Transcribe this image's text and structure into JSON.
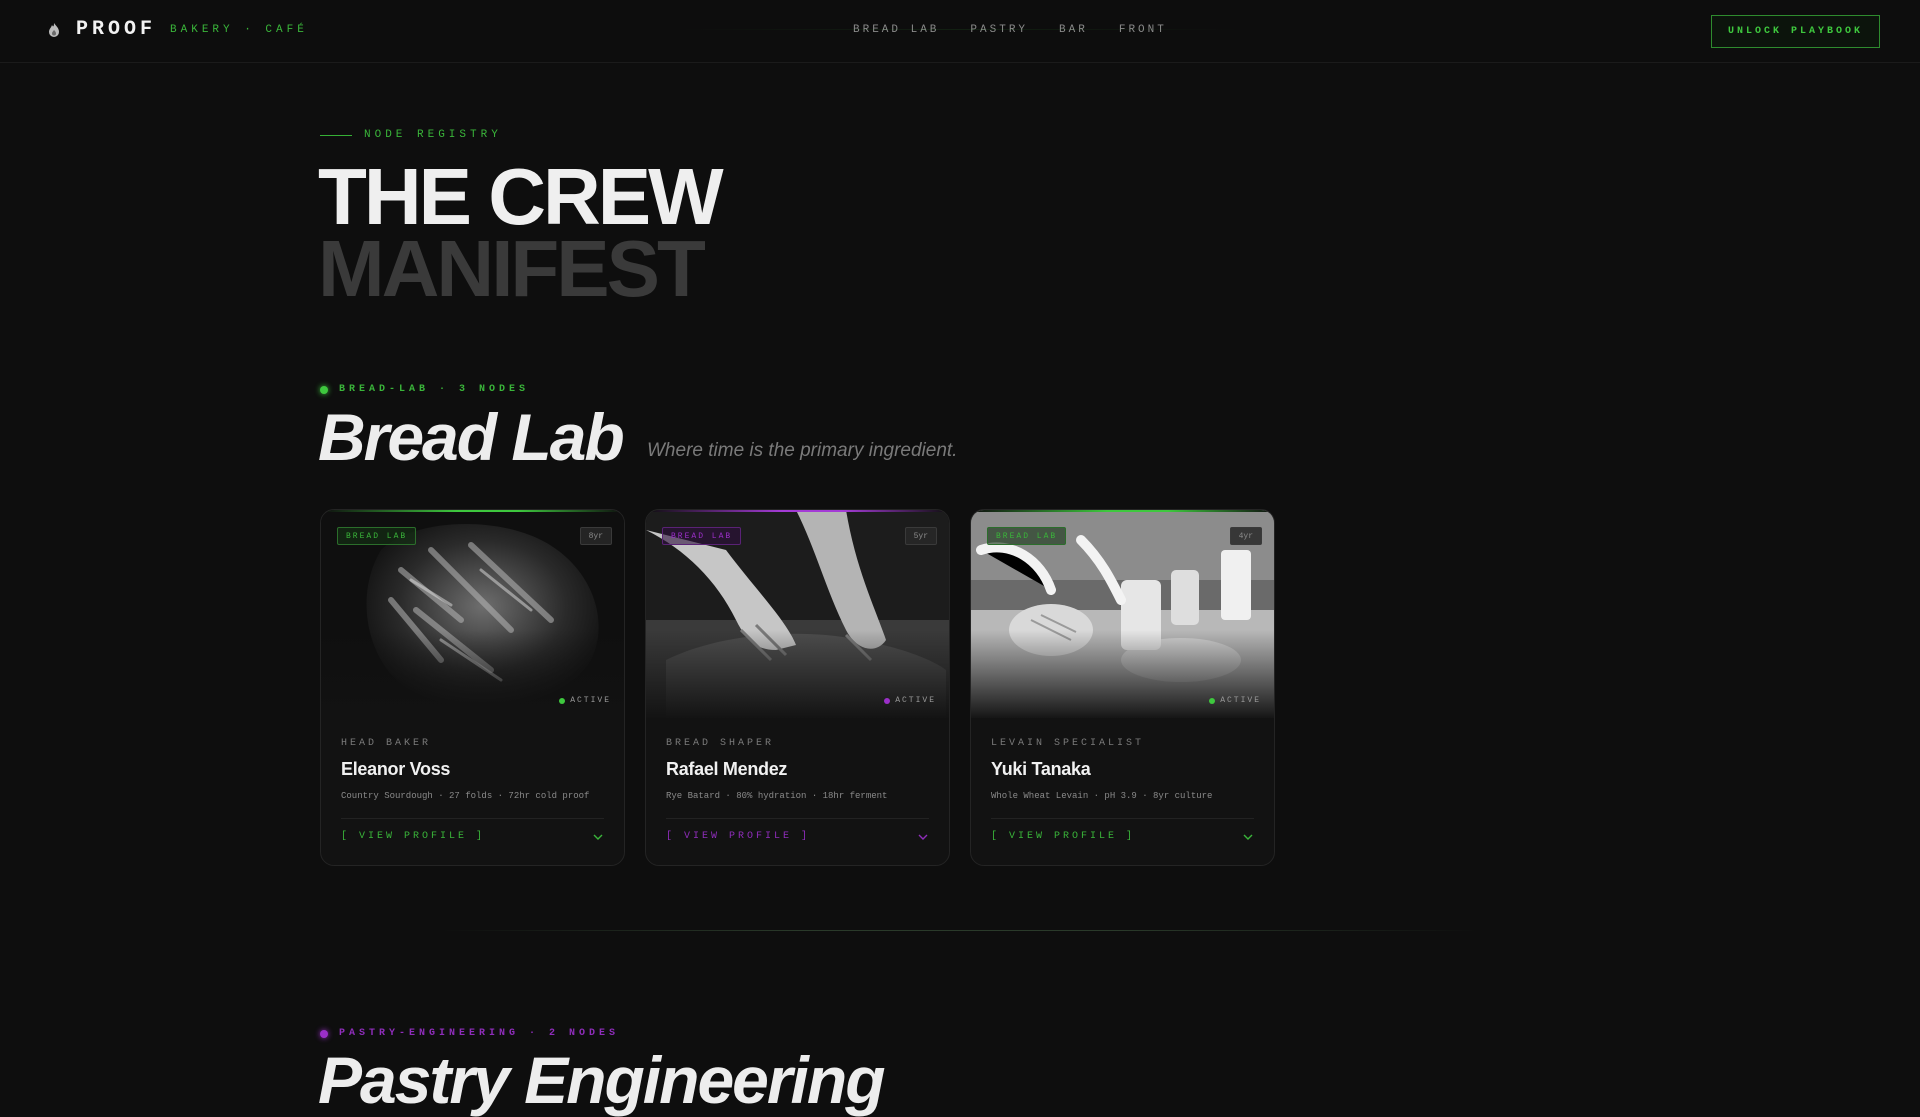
{
  "brand": {
    "name": "PROOF",
    "tagline": "BAKERY · CAFÉ",
    "logo_icon": "flame-icon"
  },
  "nav": {
    "items": [
      "BREAD LAB",
      "PASTRY",
      "BAR",
      "FRONT"
    ]
  },
  "cta": {
    "label": "UNLOCK PLAYBOOK"
  },
  "hero": {
    "eyebrow": "NODE REGISTRY",
    "line1": "THE CREW",
    "line2": "MANIFEST"
  },
  "colors": {
    "green": "#3ab53a",
    "purple": "#9b2fc9",
    "bg": "#0e0e0e"
  },
  "sections": [
    {
      "tag": "BREAD-LAB · 3 NODES",
      "title": "Bread Lab",
      "subtitle": "Where time is the primary ingredient.",
      "cards": [
        {
          "dept": "BREAD LAB",
          "years": "8yr",
          "status": "ACTIVE",
          "role": "HEAD BAKER",
          "name": "Eleanor Voss",
          "spec": "Country Sourdough · 27 folds · 72hr cold proof",
          "link": "[ VIEW PROFILE ]"
        },
        {
          "dept": "BREAD LAB",
          "years": "5yr",
          "status": "ACTIVE",
          "role": "BREAD SHAPER",
          "name": "Rafael Mendez",
          "spec": "Rye Batard · 80% hydration · 18hr ferment",
          "link": "[ VIEW PROFILE ]"
        },
        {
          "dept": "BREAD LAB",
          "years": "4yr",
          "status": "ACTIVE",
          "role": "LEVAIN SPECIALIST",
          "name": "Yuki Tanaka",
          "spec": "Whole Wheat Levain · pH 3.9 · 8yr culture",
          "link": "[ VIEW PROFILE ]"
        }
      ]
    },
    {
      "tag": "PASTRY-ENGINEERING · 2 NODES",
      "title": "Pastry Engineering"
    }
  ]
}
